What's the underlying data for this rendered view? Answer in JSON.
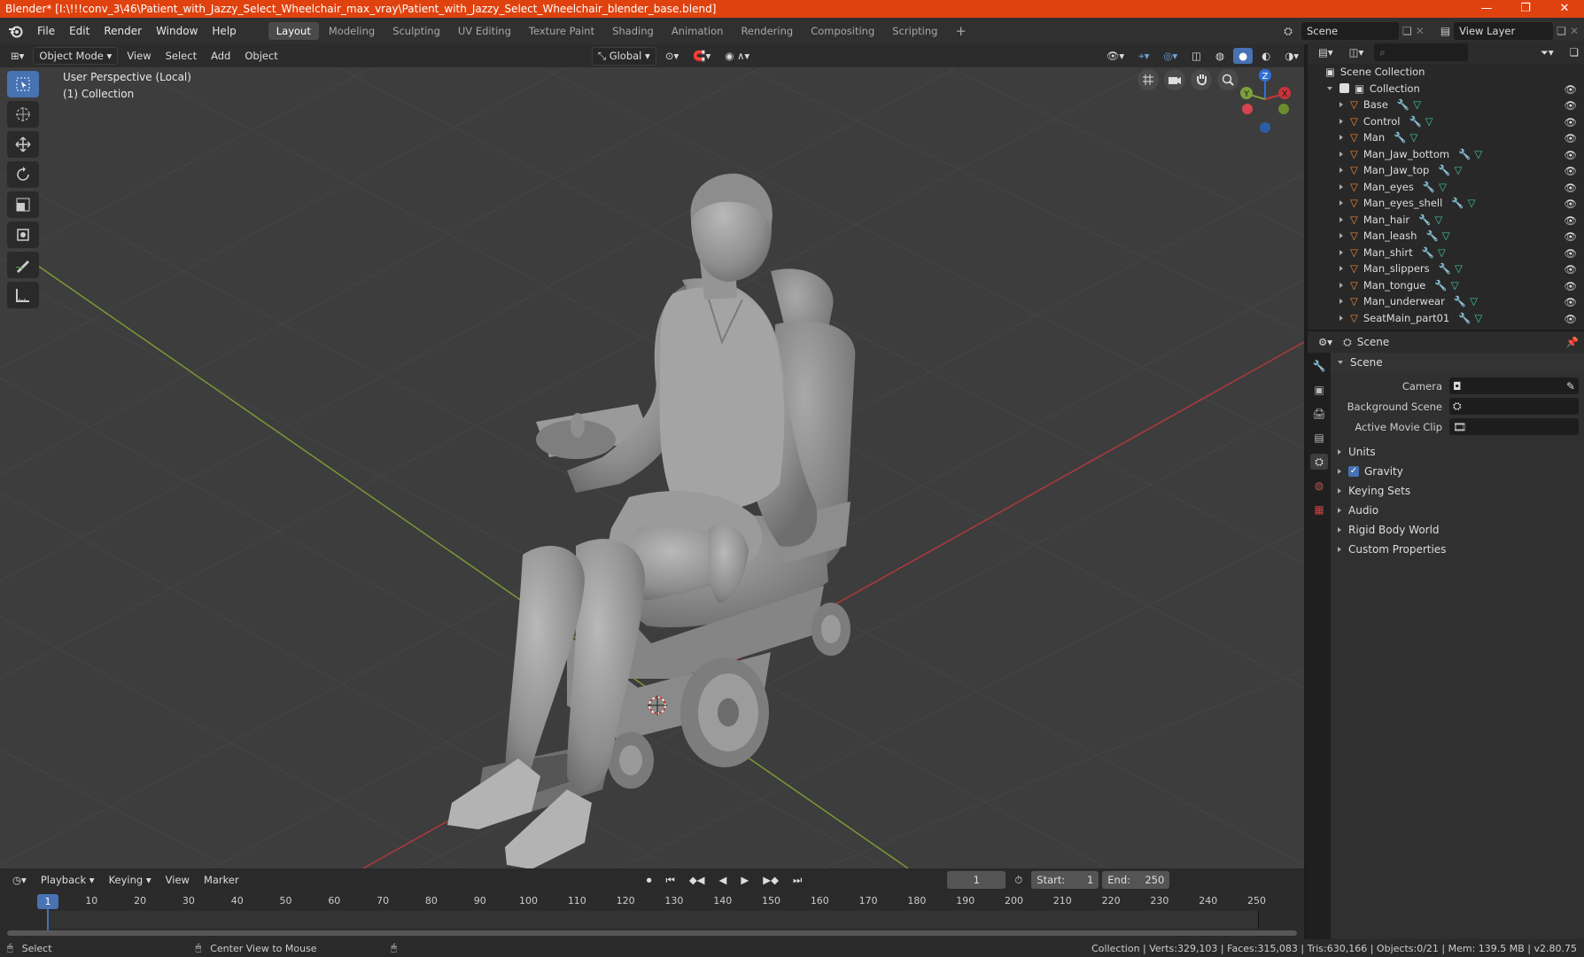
{
  "window": {
    "title": "Blender* [I:\\!!!conv_3\\46\\Patient_with_Jazzy_Select_Wheelchair_max_vray\\Patient_with_Jazzy_Select_Wheelchair_blender_base.blend]",
    "minimize": "—",
    "restore": "❐",
    "close": "✕"
  },
  "menu": {
    "items": [
      "File",
      "Edit",
      "Render",
      "Window",
      "Help"
    ],
    "workspaces": [
      "Layout",
      "Modeling",
      "Sculpting",
      "UV Editing",
      "Texture Paint",
      "Shading",
      "Animation",
      "Rendering",
      "Compositing",
      "Scripting"
    ],
    "active_workspace": "Layout",
    "add_workspace": "+",
    "scene": "Scene",
    "view_layer": "View Layer"
  },
  "viewport_header": {
    "mode": "Object Mode",
    "menus": [
      "View",
      "Select",
      "Add",
      "Object"
    ],
    "orientation": "Global"
  },
  "viewport": {
    "perspective": "User Perspective (Local)",
    "collection": "(1) Collection",
    "gizmo": {
      "x": "X",
      "y": "Y",
      "z": "Z"
    }
  },
  "outliner": {
    "root": "Scene Collection",
    "collection": "Collection",
    "objects": [
      "Base",
      "Control",
      "Man",
      "Man_Jaw_bottom",
      "Man_Jaw_top",
      "Man_eyes",
      "Man_eyes_shell",
      "Man_hair",
      "Man_leash",
      "Man_shirt",
      "Man_slippers",
      "Man_tongue",
      "Man_underwear",
      "SeatMain_part01"
    ]
  },
  "properties": {
    "header": "Scene",
    "section": "Scene",
    "fields": [
      {
        "label": "Camera",
        "value": ""
      },
      {
        "label": "Background Scene",
        "value": ""
      },
      {
        "label": "Active Movie Clip",
        "value": ""
      }
    ],
    "panels": [
      "Units",
      "Gravity",
      "Keying Sets",
      "Audio",
      "Rigid Body World",
      "Custom Properties"
    ],
    "gravity_checked": true
  },
  "timeline": {
    "menus": [
      "Playback",
      "Keying",
      "View",
      "Marker"
    ],
    "current_frame": "1",
    "start_label": "Start:",
    "start": "1",
    "end_label": "End:",
    "end": "250",
    "ticks": [
      "1",
      "10",
      "20",
      "30",
      "40",
      "50",
      "60",
      "70",
      "80",
      "90",
      "100",
      "110",
      "120",
      "130",
      "140",
      "150",
      "160",
      "170",
      "180",
      "190",
      "200",
      "210",
      "220",
      "230",
      "240",
      "250"
    ]
  },
  "status": {
    "left": "Select",
    "middle": "Center View to Mouse",
    "stats": "Collection | Verts:329,103 | Faces:315,083 | Tris:630,166 | Objects:0/21 | Mem: 139.5 MB | v2.80.75"
  },
  "colors": {
    "title_bar": "#e0420f",
    "accent": "#4772b3",
    "x_axis": "#c8333c",
    "y_axis": "#7ea03a",
    "z_axis": "#2f6fd6",
    "mesh_icon": "#e8893a"
  }
}
